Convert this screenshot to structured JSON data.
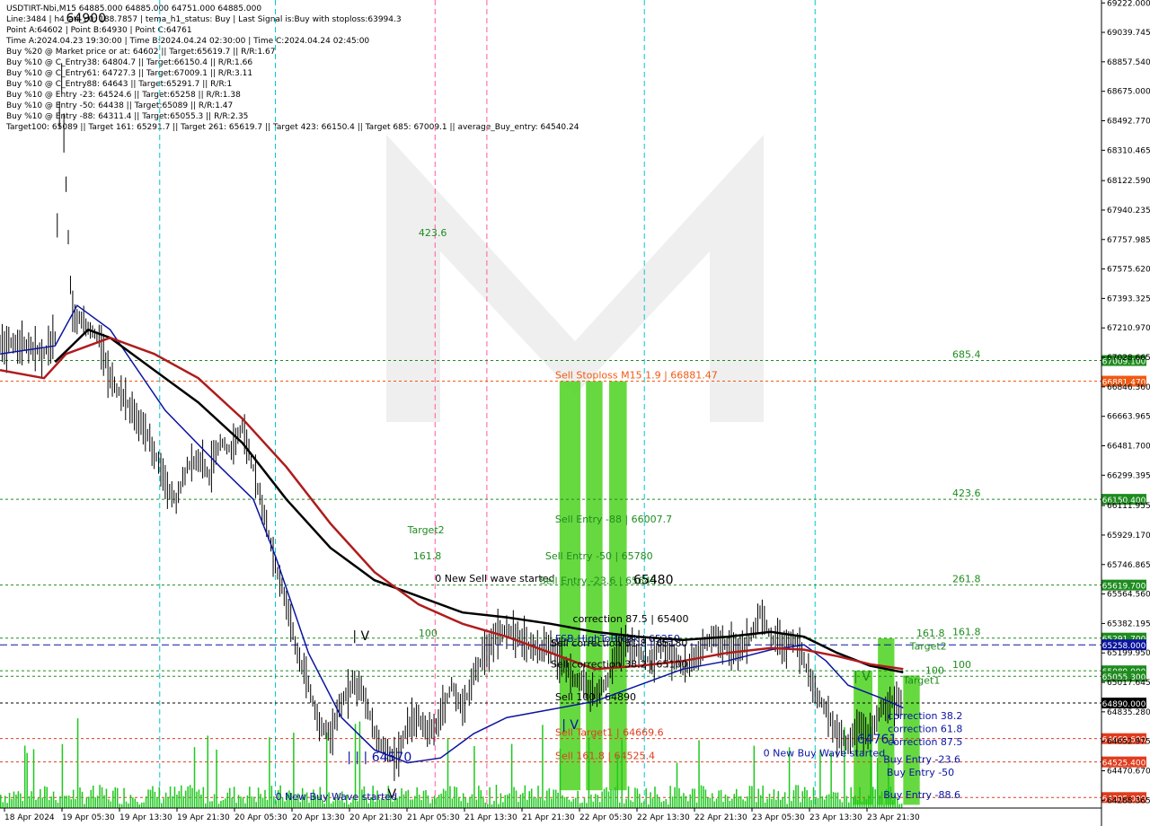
{
  "header": {
    "lines": [
      "USDTIRT-Nbi,M15  64885.000 64885.000 64751.000 64885.000",
      "Line:3484  |  h4_atr_c0: 188.7857  |  tema_h1_status: Buy  |  Last Signal is:Buy with stoploss:63994.3",
      "Point A:64602  |  Point B:64930  |  Point C:64761",
      "Time A:2024.04.23 19:30:00  |  Time B:2024.04.24 02:30:00  |  Time C:2024.04.24 02:45:00",
      "Buy %20 @ Market price or at: 64602  ||  Target:65619.7  ||  R/R:1.67",
      "Buy %10 @ C_Entry38: 64804.7  ||  Target:66150.4  ||  R/R:1.66",
      "Buy %10 @ C_Entry61: 64727.3  ||  Target:67009.1  ||  R/R:3.11",
      "Buy %10 @ C_Entry88: 64643  ||  Target:65291.7  ||  R/R:1",
      "Buy %10 @ Entry -23: 64524.6  ||  Target:65258  ||  R/R:1.38",
      "Buy %10 @ Entry -50: 64438  ||  Target:65089  ||  R/R:1.47",
      "Buy %10 @ Entry -88: 64311.4  ||  Target:65055.3  ||  R/R:2.35",
      "Target100: 65089  ||  Target 161: 65291.7  ||  Target 261: 65619.7  ||  Target 423: 66150.4  ||  Target 685: 67009.1  ||  average_Buy_entry: 64540.24"
    ]
  },
  "colors": {
    "background": "#ffffff",
    "bull_candle": "#000000",
    "ma_blue": "#0a14a0",
    "ma_black": "#000000",
    "ma_red": "#b01c1c",
    "channel_orange": "#f05a14",
    "volume_green": "#1ec81e",
    "level_green": "#1e8c1e",
    "level_red": "#e03c1e",
    "marker_cyan": "#00c8d2",
    "marker_pink": "#ff5aa0",
    "watermark": "#d2d2d2",
    "zone_green": "#4cd21e",
    "zone_orange": "#e6963c",
    "arrow_up": "#1e50ff",
    "arrow_down": "#f01e1e"
  },
  "chart_data": {
    "type": "candlestick",
    "symbol": "USDTIRT-Nbi",
    "timeframe": "M15",
    "ohlc_last": [
      64885.0,
      64885.0,
      64751.0,
      64885.0
    ],
    "ylim": [
      64240,
      69240
    ],
    "y_ticks": [
      "69222.000",
      "69039.745",
      "68857.540",
      "68675.000",
      "68492.770",
      "68310.465",
      "68122.590",
      "67940.235",
      "67757.985",
      "67575.620",
      "67393.325",
      "67210.970",
      "67028.665",
      "66846.360",
      "66663.965",
      "66481.700",
      "66299.395",
      "66111.955",
      "65929.170",
      "65746.865",
      "65564.560",
      "65382.195",
      "65199.950",
      "65017.645",
      "64835.280",
      "64652.975",
      "64470.670",
      "64288.365",
      "64111.000"
    ],
    "x_ticks": [
      "18 Apr 2024",
      "19 Apr 05:30",
      "19 Apr 13:30",
      "19 Apr 21:30",
      "20 Apr 05:30",
      "20 Apr 13:30",
      "20 Apr 21:30",
      "21 Apr 05:30",
      "21 Apr 13:30",
      "21 Apr 21:30",
      "22 Apr 05:30",
      "22 Apr 13:30",
      "22 Apr 21:30",
      "23 Apr 05:30",
      "23 Apr 13:30",
      "23 Apr 21:30"
    ],
    "price_path": [
      [
        0,
        67100
      ],
      [
        0.02,
        67120
      ],
      [
        0.04,
        67050
      ],
      [
        0.05,
        67150
      ],
      [
        0.055,
        68900
      ],
      [
        0.06,
        68100
      ],
      [
        0.065,
        67300
      ],
      [
        0.075,
        67250
      ],
      [
        0.09,
        67150
      ],
      [
        0.1,
        66900
      ],
      [
        0.11,
        66800
      ],
      [
        0.12,
        66700
      ],
      [
        0.13,
        66600
      ],
      [
        0.14,
        66450
      ],
      [
        0.15,
        66250
      ],
      [
        0.16,
        66150
      ],
      [
        0.17,
        66350
      ],
      [
        0.18,
        66400
      ],
      [
        0.19,
        66300
      ],
      [
        0.2,
        66500
      ],
      [
        0.21,
        66450
      ],
      [
        0.22,
        66600
      ],
      [
        0.23,
        66350
      ],
      [
        0.24,
        66050
      ],
      [
        0.25,
        65750
      ],
      [
        0.26,
        65500
      ],
      [
        0.27,
        65200
      ],
      [
        0.28,
        65000
      ],
      [
        0.29,
        64750
      ],
      [
        0.3,
        64700
      ],
      [
        0.31,
        64900
      ],
      [
        0.32,
        65000
      ],
      [
        0.33,
        64950
      ],
      [
        0.34,
        64700
      ],
      [
        0.35,
        64600
      ],
      [
        0.36,
        64550
      ],
      [
        0.37,
        64750
      ],
      [
        0.38,
        64800
      ],
      [
        0.39,
        64700
      ],
      [
        0.4,
        64800
      ],
      [
        0.41,
        65000
      ],
      [
        0.42,
        64850
      ],
      [
        0.43,
        65050
      ],
      [
        0.44,
        65200
      ],
      [
        0.45,
        65300
      ],
      [
        0.46,
        65350
      ],
      [
        0.47,
        65300
      ],
      [
        0.48,
        65250
      ],
      [
        0.49,
        65200
      ],
      [
        0.5,
        65250
      ],
      [
        0.51,
        65150
      ],
      [
        0.52,
        65050
      ],
      [
        0.53,
        65000
      ],
      [
        0.54,
        64950
      ],
      [
        0.55,
        65000
      ],
      [
        0.56,
        65200
      ],
      [
        0.57,
        65250
      ],
      [
        0.58,
        65200
      ],
      [
        0.59,
        65150
      ],
      [
        0.6,
        65250
      ],
      [
        0.61,
        65200
      ],
      [
        0.62,
        65100
      ],
      [
        0.63,
        65150
      ],
      [
        0.64,
        65250
      ],
      [
        0.65,
        65300
      ],
      [
        0.66,
        65250
      ],
      [
        0.67,
        65200
      ],
      [
        0.68,
        65280
      ],
      [
        0.69,
        65450
      ],
      [
        0.7,
        65300
      ],
      [
        0.71,
        65250
      ],
      [
        0.72,
        65300
      ],
      [
        0.73,
        65150
      ],
      [
        0.74,
        64950
      ],
      [
        0.75,
        64850
      ],
      [
        0.76,
        64700
      ],
      [
        0.77,
        64650
      ],
      [
        0.78,
        64750
      ],
      [
        0.79,
        64700
      ],
      [
        0.8,
        64850
      ],
      [
        0.81,
        64900
      ],
      [
        0.82,
        64885
      ]
    ],
    "moving_averages": [
      {
        "color": "blue",
        "points": [
          [
            0,
            67050
          ],
          [
            0.05,
            67100
          ],
          [
            0.07,
            67350
          ],
          [
            0.1,
            67200
          ],
          [
            0.15,
            66700
          ],
          [
            0.2,
            66350
          ],
          [
            0.23,
            66150
          ],
          [
            0.25,
            65800
          ],
          [
            0.28,
            65200
          ],
          [
            0.31,
            64800
          ],
          [
            0.34,
            64600
          ],
          [
            0.37,
            64520
          ],
          [
            0.4,
            64550
          ],
          [
            0.43,
            64700
          ],
          [
            0.46,
            64800
          ],
          [
            0.5,
            64850
          ],
          [
            0.54,
            64900
          ],
          [
            0.58,
            65000
          ],
          [
            0.62,
            65100
          ],
          [
            0.66,
            65150
          ],
          [
            0.7,
            65220
          ],
          [
            0.73,
            65250
          ],
          [
            0.75,
            65150
          ],
          [
            0.77,
            65000
          ],
          [
            0.8,
            64920
          ],
          [
            0.82,
            64860
          ]
        ]
      },
      {
        "color": "black",
        "points": [
          [
            0.05,
            67000
          ],
          [
            0.08,
            67200
          ],
          [
            0.1,
            67150
          ],
          [
            0.14,
            66950
          ],
          [
            0.18,
            66750
          ],
          [
            0.22,
            66500
          ],
          [
            0.26,
            66150
          ],
          [
            0.3,
            65850
          ],
          [
            0.34,
            65650
          ],
          [
            0.38,
            65550
          ],
          [
            0.42,
            65450
          ],
          [
            0.46,
            65420
          ],
          [
            0.5,
            65380
          ],
          [
            0.54,
            65330
          ],
          [
            0.58,
            65300
          ],
          [
            0.62,
            65280
          ],
          [
            0.66,
            65300
          ],
          [
            0.7,
            65330
          ],
          [
            0.73,
            65300
          ],
          [
            0.76,
            65200
          ],
          [
            0.79,
            65120
          ],
          [
            0.82,
            65080
          ]
        ]
      },
      {
        "color": "red",
        "points": [
          [
            0,
            66950
          ],
          [
            0.04,
            66900
          ],
          [
            0.06,
            67050
          ],
          [
            0.1,
            67150
          ],
          [
            0.14,
            67050
          ],
          [
            0.18,
            66900
          ],
          [
            0.22,
            66650
          ],
          [
            0.26,
            66350
          ],
          [
            0.3,
            66000
          ],
          [
            0.34,
            65700
          ],
          [
            0.38,
            65500
          ],
          [
            0.42,
            65380
          ],
          [
            0.46,
            65300
          ],
          [
            0.5,
            65200
          ],
          [
            0.54,
            65100
          ],
          [
            0.58,
            65120
          ],
          [
            0.62,
            65150
          ],
          [
            0.66,
            65200
          ],
          [
            0.7,
            65230
          ],
          [
            0.73,
            65220
          ],
          [
            0.76,
            65180
          ],
          [
            0.79,
            65130
          ],
          [
            0.82,
            65100
          ]
        ]
      }
    ],
    "horizontal_levels": [
      {
        "value": 67009.1,
        "label": "685.4",
        "tag": "67009.100",
        "color": "green"
      },
      {
        "value": 66881.47,
        "label": "Sell Stoploss M15 1.9 | 66881.47",
        "tag": "66881.470",
        "color": "orange"
      },
      {
        "value": 66150.4,
        "label": "423.6",
        "tag": "66150.400",
        "color": "green"
      },
      {
        "value": 65619.7,
        "label": "261.8",
        "tag": "65619.700",
        "color": "green"
      },
      {
        "value": 65291.7,
        "label": "161.8",
        "tag": "65291.700",
        "color": "green"
      },
      {
        "value": 65250,
        "label": "FSB-HighToBreak | 65250",
        "tag": "65258.000",
        "color": "blue"
      },
      {
        "value": 65089,
        "label": "100",
        "tag": "65089.000",
        "color": "green"
      },
      {
        "value": 65055.3,
        "label": "",
        "tag": "65055.300",
        "color": "green"
      },
      {
        "value": 64890,
        "label": "Sell 100 | 64890",
        "tag": "64890.000",
        "color": "black"
      },
      {
        "value": 64669.6,
        "label": "Sell Target1 | 64669.6",
        "tag": "64669.600",
        "color": "red"
      },
      {
        "value": 64525.4,
        "label": "Sell 161.8 | 64525.4",
        "tag": "64525.400",
        "color": "red"
      },
      {
        "value": 64305,
        "label": "",
        "tag": "64305.000",
        "color": "red"
      }
    ],
    "annotations": [
      {
        "text": "64900",
        "x": 0.06,
        "y": 69100,
        "color": "black"
      },
      {
        "text": "423.6",
        "x": 0.38,
        "y": 67780,
        "color": "green"
      },
      {
        "text": "Target2",
        "x": 0.37,
        "y": 65940,
        "color": "green"
      },
      {
        "text": "161.8",
        "x": 0.375,
        "y": 65780,
        "color": "green"
      },
      {
        "text": "0 New Sell wave started",
        "x": 0.395,
        "y": 65640,
        "color": "black"
      },
      {
        "text": "100",
        "x": 0.38,
        "y": 65300,
        "color": "green"
      },
      {
        "text": "Sell Entry -88 | 66007.7",
        "x": 0.504,
        "y": 66007.7,
        "color": "green"
      },
      {
        "text": "Sell Entry -50 | 65780",
        "x": 0.495,
        "y": 65780,
        "color": "green"
      },
      {
        "text": "Sell Entry -23.6 | 65645",
        "x": 0.49,
        "y": 65625,
        "color": "green"
      },
      {
        "text": "65480",
        "x": 0.575,
        "y": 65625,
        "color": "black"
      },
      {
        "text": "correction 87.5 | 65400",
        "x": 0.52,
        "y": 65390,
        "color": "black"
      },
      {
        "text": "Sell correction 61.8 | 65180",
        "x": 0.5,
        "y": 65240,
        "color": "black"
      },
      {
        "text": "Sell correction 38.2 | 65100",
        "x": 0.5,
        "y": 65110,
        "color": "black"
      },
      {
        "text": "| V",
        "x": 0.51,
        "y": 64730,
        "color": "blue"
      },
      {
        "text": "| | | 64570",
        "x": 0.315,
        "y": 64530,
        "color": "blue"
      },
      {
        "text": "V",
        "x": 0.352,
        "y": 64300,
        "color": "black"
      },
      {
        "text": "| V",
        "x": 0.32,
        "y": 65280,
        "color": "black"
      },
      {
        "text": "0 New Buy Wave started",
        "x": 0.25,
        "y": 64290,
        "color": "blue"
      },
      {
        "text": "0 New Buy Wave started",
        "x": 0.693,
        "y": 64560,
        "color": "blue"
      },
      {
        "text": "| V",
        "x": 0.775,
        "y": 65030,
        "color": "green"
      },
      {
        "text": "64761",
        "x": 0.778,
        "y": 64640,
        "color": "blue"
      },
      {
        "text": "161.8",
        "x": 0.832,
        "y": 65300,
        "color": "green"
      },
      {
        "text": "Target2",
        "x": 0.826,
        "y": 65220,
        "color": "green"
      },
      {
        "text": "100",
        "x": 0.84,
        "y": 65070,
        "color": "green"
      },
      {
        "text": "Target1",
        "x": 0.82,
        "y": 65010,
        "color": "green"
      },
      {
        "text": "correction 38.2",
        "x": 0.806,
        "y": 64790,
        "color": "blue"
      },
      {
        "text": "correction 61.8",
        "x": 0.806,
        "y": 64710,
        "color": "blue"
      },
      {
        "text": "correction 87.5",
        "x": 0.806,
        "y": 64630,
        "color": "blue"
      },
      {
        "text": "Buy Entry -23.6",
        "x": 0.802,
        "y": 64520,
        "color": "blue"
      },
      {
        "text": "Buy Entry -50",
        "x": 0.805,
        "y": 64440,
        "color": "blue"
      },
      {
        "text": "Buy Entry -88.6",
        "x": 0.802,
        "y": 64300,
        "color": "blue"
      }
    ],
    "zones": [
      {
        "x_from": 0.508,
        "x_to": 0.527,
        "y_from": 64350,
        "y_to": 66881,
        "color": "green"
      },
      {
        "x_from": 0.532,
        "x_to": 0.547,
        "y_from": 64350,
        "y_to": 66881,
        "color": "green"
      },
      {
        "x_from": 0.553,
        "x_to": 0.569,
        "y_from": 64350,
        "y_to": 66881,
        "color": "green"
      },
      {
        "x_from": 0.775,
        "x_to": 0.792,
        "y_from": 64260,
        "y_to": 65090,
        "color": "green"
      },
      {
        "x_from": 0.797,
        "x_to": 0.812,
        "y_from": 64260,
        "y_to": 65290,
        "color": "green"
      },
      {
        "x_from": 0.82,
        "x_to": 0.835,
        "y_from": 64260,
        "y_to": 65060,
        "color": "green"
      }
    ],
    "vertical_markers": [
      {
        "x": 0.145,
        "color": "cyan"
      },
      {
        "x": 0.25,
        "color": "cyan"
      },
      {
        "x": 0.395,
        "color": "pink"
      },
      {
        "x": 0.442,
        "color": "pink"
      },
      {
        "x": 0.585,
        "color": "cyan"
      },
      {
        "x": 0.74,
        "color": "cyan"
      }
    ]
  }
}
